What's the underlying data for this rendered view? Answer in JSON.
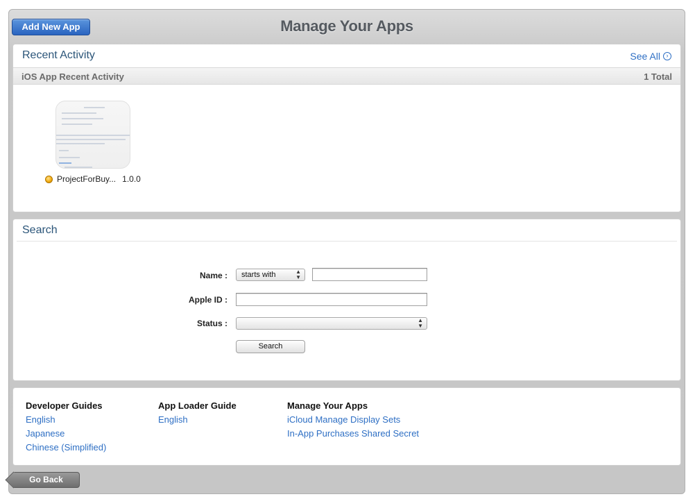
{
  "header": {
    "title": "Manage Your Apps",
    "add_app_label": "Add New App"
  },
  "recent": {
    "title": "Recent Activity",
    "see_all": "See All",
    "subheader": "iOS App Recent Activity",
    "total": "1 Total",
    "apps": [
      {
        "name": "ProjectForBuy...",
        "version": "1.0.0",
        "status_color": "#f0a90a"
      }
    ]
  },
  "search": {
    "title": "Search",
    "name_label": "Name :",
    "name_mode": "starts with",
    "name_value": "",
    "apple_id_label": "Apple ID :",
    "apple_id_value": "",
    "status_label": "Status :",
    "status_value": "",
    "button": "Search"
  },
  "footer": {
    "columns": [
      {
        "heading": "Developer Guides",
        "links": [
          "English",
          "Japanese",
          "Chinese (Simplified)"
        ]
      },
      {
        "heading": "App Loader Guide",
        "links": [
          "English"
        ]
      },
      {
        "heading": "Manage Your Apps",
        "links": [
          "iCloud Manage Display Sets",
          "In-App Purchases Shared Secret"
        ]
      }
    ]
  },
  "nav": {
    "go_back": "Go Back"
  },
  "colors": {
    "accent": "#2e6fc4",
    "title": "#2b5579",
    "button_blue": "#2a64c0"
  }
}
